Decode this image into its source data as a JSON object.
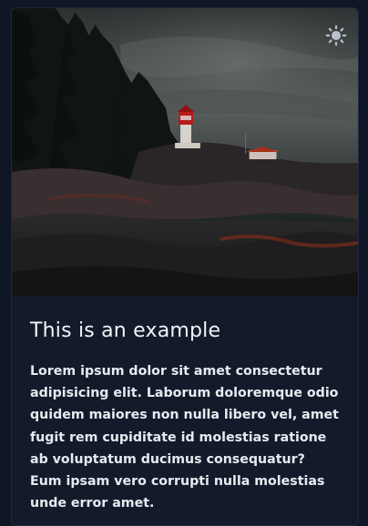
{
  "card": {
    "image_alt": "Lighthouse on a rocky shore under a cloudy sky",
    "title": "This is an example",
    "body": "Lorem ipsum dolor sit amet consectetur adipisicing elit. Laborum doloremque odio quidem maiores non nulla libero vel, amet fugit rem cupiditate id molestias ratione ab voluptatum ducimus consequatur? Eum ipsam vero corrupti nulla molestias unde error amet."
  },
  "toggle": {
    "icon": "sun-icon"
  },
  "colors": {
    "page_bg": "#0f1726",
    "card_bg": "#131b2b",
    "text": "#e7ebf1"
  }
}
